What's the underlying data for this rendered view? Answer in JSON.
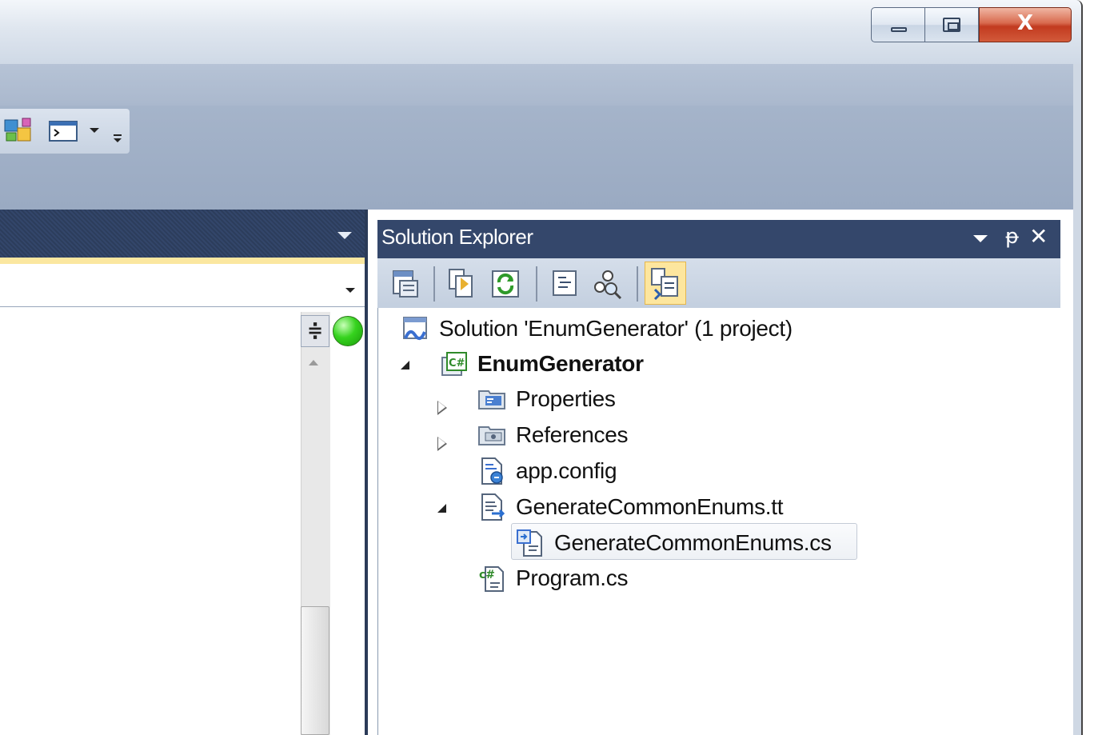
{
  "window": {
    "minimize_glyph": "",
    "close_glyph": "X"
  },
  "editor": {
    "splitter_glyph": "≑"
  },
  "solution_explorer": {
    "title": "Solution Explorer",
    "pin_glyph": "ᵽ",
    "close_glyph": "✕",
    "toolbar": [
      "properties-icon",
      "show-all-files-icon",
      "refresh-icon",
      "view-code-icon",
      "class-view-icon",
      "transform-templates-icon"
    ],
    "tree": {
      "solution": "Solution 'EnumGenerator' (1 project)",
      "project": "EnumGenerator",
      "items": [
        {
          "label": "Properties",
          "expander": "collapsed"
        },
        {
          "label": "References",
          "expander": "collapsed"
        },
        {
          "label": "app.config",
          "expander": "none"
        },
        {
          "label": "GenerateCommonEnums.tt",
          "expander": "expanded"
        },
        {
          "label": "GenerateCommonEnums.cs",
          "expander": "none",
          "selected": true
        },
        {
          "label": "Program.cs",
          "expander": "none"
        }
      ]
    }
  },
  "colors": {
    "tool_window_header": "#34476b",
    "accent_yellow": "#fde69e",
    "status_green": "#36d31e"
  }
}
